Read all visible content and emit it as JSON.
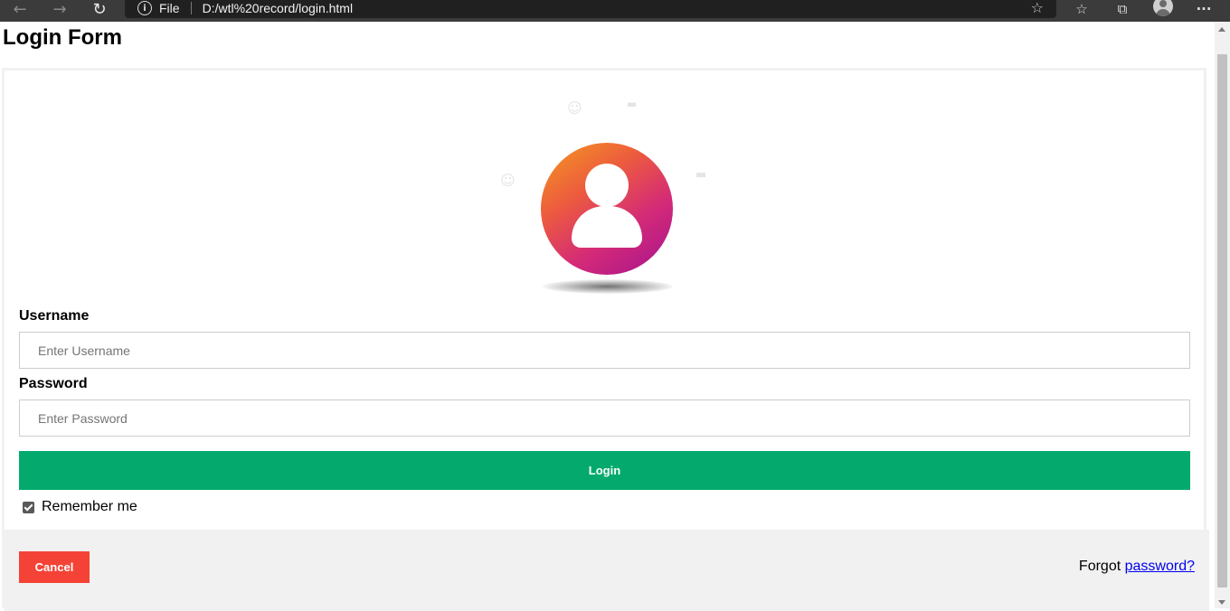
{
  "browser": {
    "address_prefix": "File",
    "url": "D:/wtl%20record/login.html",
    "icons": {
      "back": "arrow-left",
      "forward": "arrow-right",
      "refresh": "refresh",
      "info": "info",
      "favorite": "star-add",
      "favorites": "favorites-list",
      "collections": "collections",
      "profile": "profile",
      "menu": "more"
    }
  },
  "page": {
    "title": "Login Form",
    "avatar_icon": "user-avatar-icon",
    "username": {
      "label": "Username",
      "placeholder": "Enter Username",
      "value": ""
    },
    "password": {
      "label": "Password",
      "placeholder": "Enter Password",
      "value": ""
    },
    "login_button": "Login",
    "remember_me": {
      "label": "Remember me",
      "checked": true
    },
    "cancel_button": "Cancel",
    "forgot_prefix": "Forgot",
    "forgot_link": "password?"
  },
  "colors": {
    "login_button": "#04aa6d",
    "cancel_button": "#f44336",
    "link": "#0000ee",
    "footer_bg": "#f1f1f1"
  }
}
